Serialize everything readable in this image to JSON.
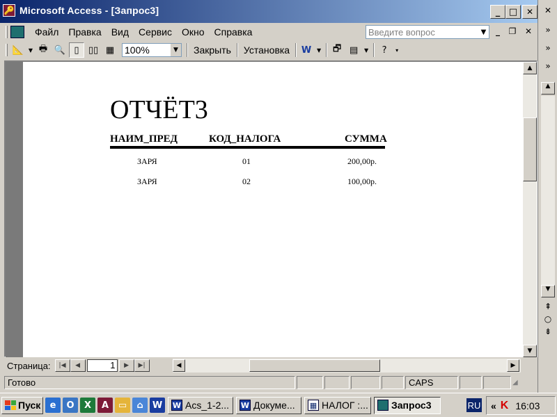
{
  "window": {
    "app_icon": "access-key-icon",
    "title": "Microsoft Access - [Запрос3]",
    "minimize": "_",
    "maximize": "□",
    "close": "✕"
  },
  "menu": {
    "items": [
      "Файл",
      "Правка",
      "Вид",
      "Сервис",
      "Окно",
      "Справка"
    ],
    "ask_placeholder": "Введите вопрос"
  },
  "toolbar": {
    "zoom": "100%",
    "close_label": "Закрыть",
    "setup_label": "Установка"
  },
  "report": {
    "title": "ОТЧЁТ3",
    "columns": [
      "НАИМ_ПРЕД",
      "КОД_НАЛОГА",
      "СУММА"
    ],
    "rows": [
      [
        "ЗАРЯ",
        "01",
        "200,00р."
      ],
      [
        "ЗАРЯ",
        "02",
        "100,00р."
      ]
    ]
  },
  "navigation": {
    "page_label": "Страница:",
    "page_number": "1"
  },
  "status": {
    "text": "Готово",
    "caps": "CAPS"
  },
  "taskbar": {
    "start": "Пуск",
    "tasks": [
      "Acs_1-2...",
      "Докуме...",
      "НАЛОГ :...",
      "Запрос3"
    ],
    "lang": "RU",
    "chevron": "«",
    "clock": "16:03"
  }
}
